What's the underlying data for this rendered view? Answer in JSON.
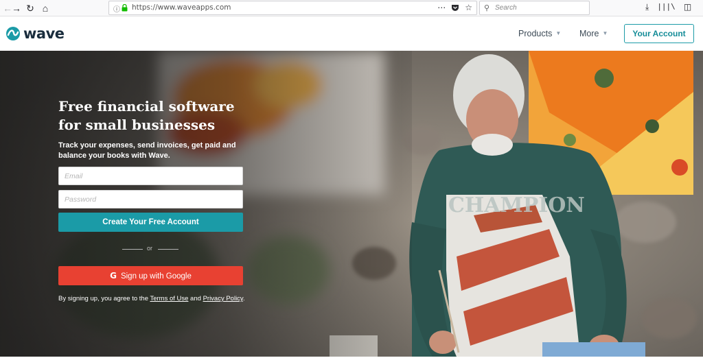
{
  "browser": {
    "url": "https://www.waveapps.com",
    "search_placeholder": "Search",
    "icons": [
      "back-icon",
      "forward-icon",
      "reload-icon",
      "home-icon",
      "info-icon",
      "lock-icon",
      "page-actions-icon",
      "pocket-icon",
      "bookmark-star-icon",
      "search-icon",
      "download-icon",
      "library-icon",
      "sidebar-icon"
    ]
  },
  "header": {
    "logo_text": "wave",
    "nav": [
      {
        "label": "Products"
      },
      {
        "label": "More"
      }
    ],
    "account_button": "Your Account"
  },
  "hero": {
    "title_line1": "Free financial software",
    "title_line2": "for small businesses",
    "subtitle": "Track your expenses, send invoices, get paid and balance your books with Wave.",
    "email_placeholder": "Email",
    "password_placeholder": "Password",
    "cta_label": "Create Your Free Account",
    "or_label": "or",
    "google_label": "Sign up with Google",
    "terms_prefix": "By signing up, you agree to the ",
    "terms_link": "Terms of Use",
    "terms_and": " and ",
    "privacy_link": "Privacy Policy",
    "terms_suffix": "."
  },
  "colors": {
    "teal": "#1b9ba7",
    "google_red": "#e84132",
    "logo_dark": "#1a2d3d"
  }
}
